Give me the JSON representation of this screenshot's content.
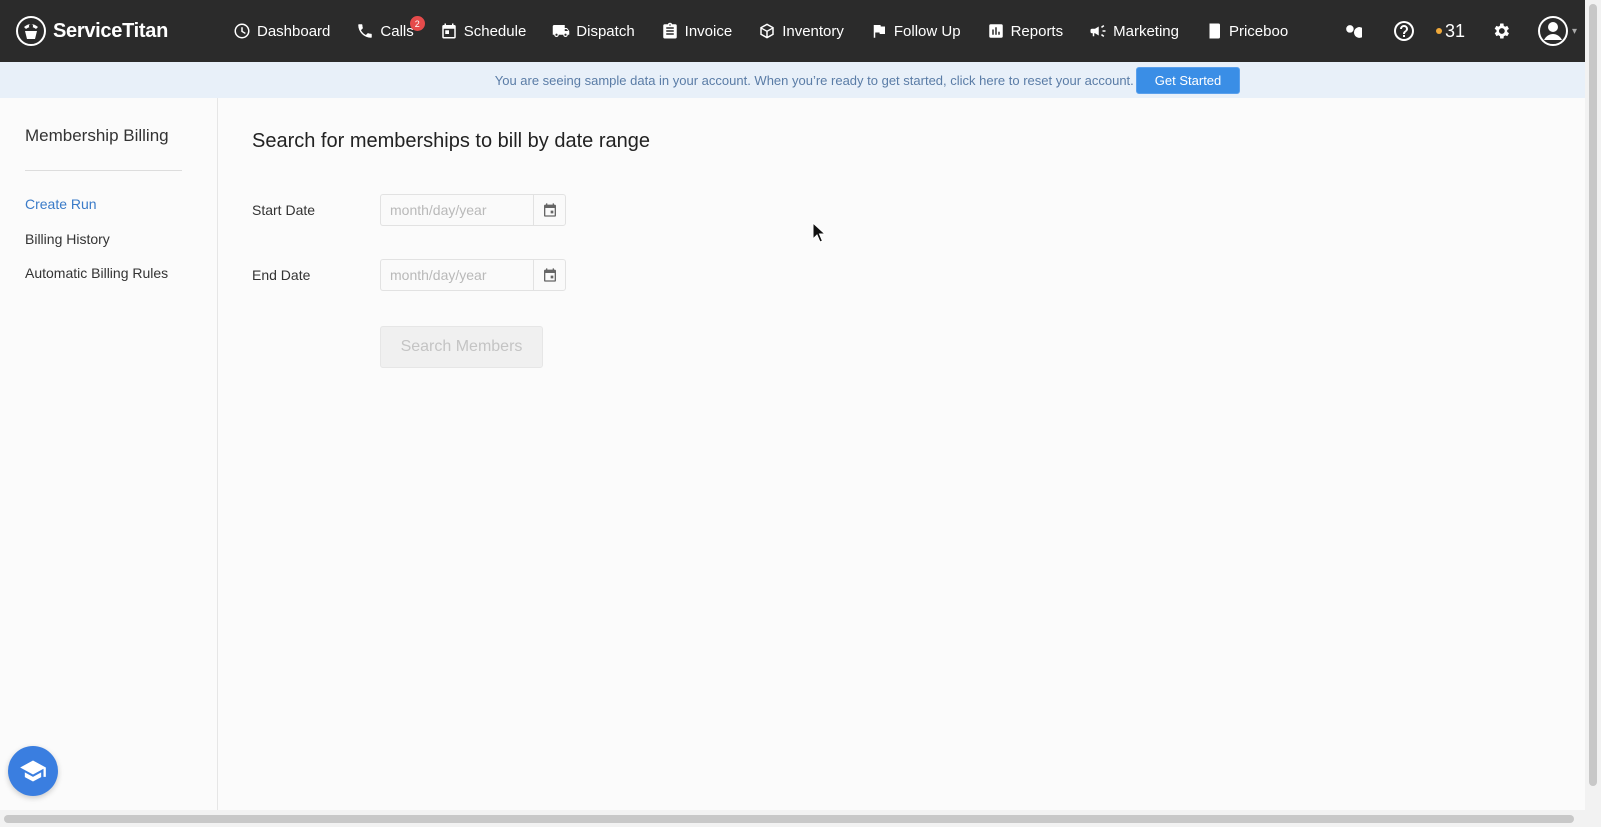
{
  "app": {
    "brand": "ServiceTitan"
  },
  "nav": {
    "items": [
      {
        "label": "Dashboard",
        "icon": "dashboard-icon"
      },
      {
        "label": "Calls",
        "icon": "phone-icon",
        "badge": "2"
      },
      {
        "label": "Schedule",
        "icon": "calendar-icon"
      },
      {
        "label": "Dispatch",
        "icon": "truck-icon"
      },
      {
        "label": "Invoice",
        "icon": "clipboard-icon"
      },
      {
        "label": "Inventory",
        "icon": "box-icon"
      },
      {
        "label": "Follow Up",
        "icon": "flag-icon"
      },
      {
        "label": "Reports",
        "icon": "bar-chart-icon"
      },
      {
        "label": "Marketing",
        "icon": "megaphone-icon"
      },
      {
        "label": "Priceboo",
        "icon": "book-icon"
      }
    ],
    "notification_count": "31"
  },
  "banner": {
    "message": "You are seeing sample data in your account. When you’re ready to get started, click here to reset your account.",
    "button_label": "Get Started"
  },
  "sidebar": {
    "title": "Membership Billing",
    "links": [
      {
        "label": "Create Run",
        "active": true
      },
      {
        "label": "Billing History",
        "active": false
      },
      {
        "label": "Automatic Billing Rules",
        "active": false
      }
    ]
  },
  "main": {
    "heading": "Search for memberships to bill by date range",
    "start_date": {
      "label": "Start Date",
      "placeholder": "month/day/year",
      "value": ""
    },
    "end_date": {
      "label": "End Date",
      "placeholder": "month/day/year",
      "value": ""
    },
    "search_button": "Search Members"
  },
  "colors": {
    "nav_bg": "#2b2b2b",
    "accent": "#3a8ee6",
    "active_link": "#3a7bc8",
    "badge": "#e54b4b"
  }
}
